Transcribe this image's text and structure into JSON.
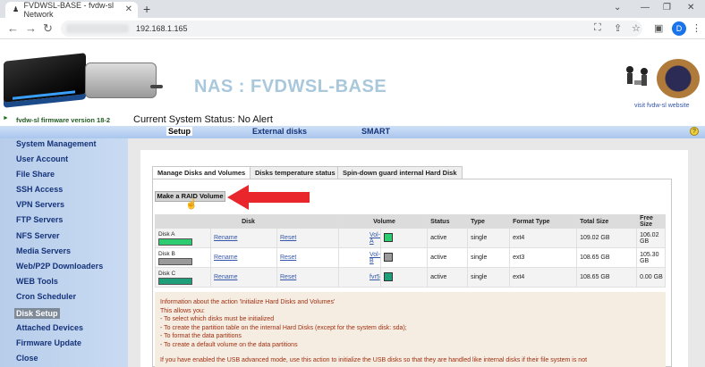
{
  "browser": {
    "tab_title": "FVDWSL-BASE - fvdw-sl Network",
    "url": "192.168.1.165",
    "avatar_letter": "D"
  },
  "header": {
    "title": "NAS : FVDWSL-BASE",
    "visit_link": "visit fvdw-sl website",
    "firmware": "fvdw-sl firmware version 18-2",
    "system_status": "Current System Status:  No Alert"
  },
  "topnav": {
    "items": [
      "Setup",
      "External disks",
      "SMART"
    ]
  },
  "sidebar": {
    "items": [
      "System Management",
      "User Account",
      "File Share",
      "SSH Access",
      "VPN Servers",
      "FTP Servers",
      "NFS Server",
      "Media Servers",
      "Web/P2P Downloaders",
      "WEB Tools",
      "Cron Scheduler",
      "Disk Setup",
      "Attached Devices",
      "Firmware Update",
      "Close"
    ],
    "selected": "Disk Setup"
  },
  "tabs": [
    "Manage Disks and Volumes",
    "Disks temperature status",
    "Spin-down guard internal Hard Disk"
  ],
  "raid_button": "Make a RAID Volume",
  "table": {
    "headers": [
      "Disk",
      "Volume",
      "Status",
      "Type",
      "Format Type",
      "Total Size",
      "Free Size"
    ],
    "rows": [
      {
        "disk": "Disk A",
        "color": "#2ecc71",
        "rename": "Rename",
        "reset": "Reset",
        "volume": "Vol-A",
        "vcolor": "#2ecc71",
        "status": "active",
        "type": "single",
        "format": "ext4",
        "total": "109.02 GB",
        "free": "106.02 GB"
      },
      {
        "disk": "Disk B",
        "color": "#9a9a9a",
        "rename": "Rename",
        "reset": "Reset",
        "volume": "Vol-B",
        "vcolor": "#9a9a9a",
        "status": "active",
        "type": "single",
        "format": "ext3",
        "total": "108.65 GB",
        "free": "105.30 GB"
      },
      {
        "disk": "Disk C",
        "color": "#1e9f7a",
        "rename": "Rename",
        "reset": "Reset",
        "volume": "fvr5",
        "vcolor": "#1e9f7a",
        "status": "active",
        "type": "single",
        "format": "ext4",
        "total": "108.65 GB",
        "free": "0.00 GB"
      }
    ]
  },
  "info": {
    "line1": "Information about the action 'Initialize Hard Disks and Volumes'",
    "line2": "This allows you:",
    "line3": "- To select which disks must be initialized",
    "line4": "- To create the partition table on the internal Hard Disks (except for the system disk: sda);",
    "line5": "- To format the data partitions",
    "line6": "- To create a default volume on the data partitions",
    "note": "If you have enabled the USB advanced mode, use this action to initialize the USB disks so that they are handled like internal disks if their file system is not"
  }
}
